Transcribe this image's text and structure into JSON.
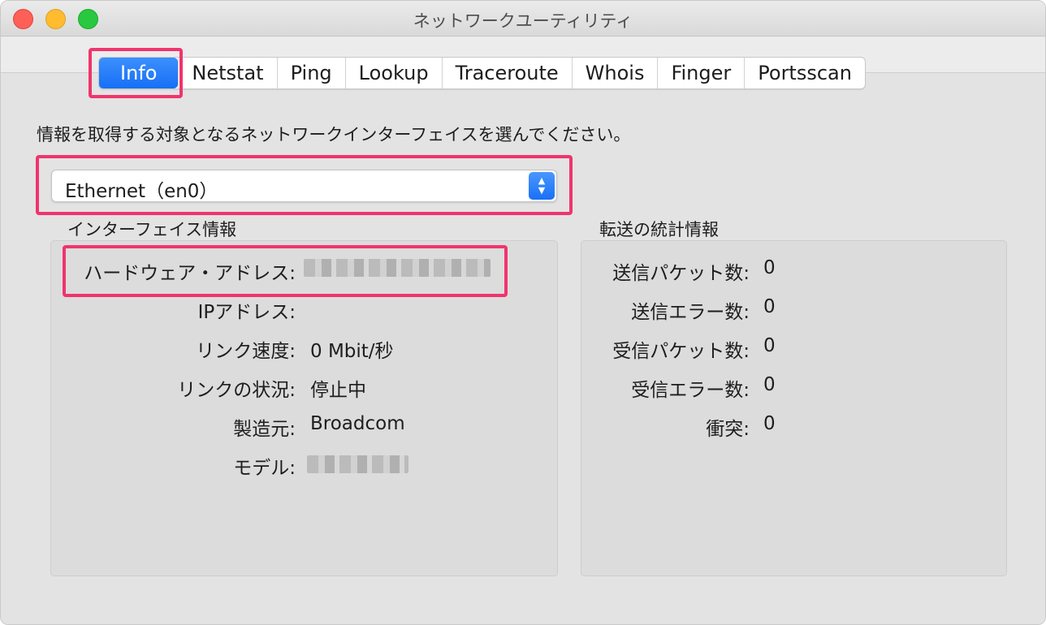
{
  "window": {
    "title": "ネットワークユーティリティ"
  },
  "tabs": [
    {
      "label": "Info",
      "active": true
    },
    {
      "label": "Netstat",
      "active": false
    },
    {
      "label": "Ping",
      "active": false
    },
    {
      "label": "Lookup",
      "active": false
    },
    {
      "label": "Traceroute",
      "active": false
    },
    {
      "label": "Whois",
      "active": false
    },
    {
      "label": "Finger",
      "active": false
    },
    {
      "label": "Portsscan",
      "active": false
    }
  ],
  "instruction": "情報を取得する対象となるネットワークインターフェイスを選んでください。",
  "interface_select": {
    "value": "Ethernet（en0）"
  },
  "interface_info": {
    "title": "インターフェイス情報",
    "rows": [
      {
        "label": "ハードウェア・アドレス:",
        "value": ""
      },
      {
        "label": "IPアドレス:",
        "value": ""
      },
      {
        "label": "リンク速度:",
        "value": "0 Mbit/秒"
      },
      {
        "label": "リンクの状況:",
        "value": "停止中"
      },
      {
        "label": "製造元:",
        "value": "Broadcom"
      },
      {
        "label": "モデル:",
        "value": ""
      }
    ]
  },
  "transfer_stats": {
    "title": "転送の統計情報",
    "rows": [
      {
        "label": "送信パケット数:",
        "value": "0"
      },
      {
        "label": "送信エラー数:",
        "value": "0"
      },
      {
        "label": "受信パケット数:",
        "value": "0"
      },
      {
        "label": "受信エラー数:",
        "value": "0"
      },
      {
        "label": "衝突:",
        "value": "0"
      }
    ]
  },
  "colors": {
    "accent": "#1670f6",
    "highlight": "#f0346d"
  }
}
